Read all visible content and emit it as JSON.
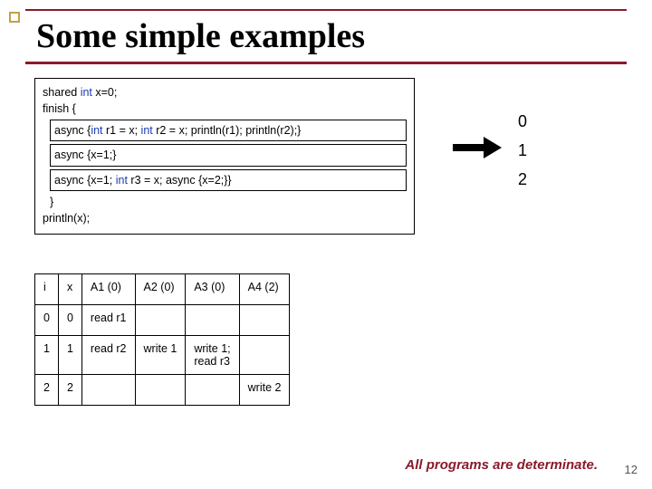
{
  "title": "Some simple examples",
  "code": {
    "line1_pre": "shared ",
    "line1_kw": "int",
    "line1_post": " x=0;",
    "line2": "finish {",
    "box1_pre": "async {",
    "box1_kw1": "int",
    "box1_mid1": " r1 = x; ",
    "box1_kw2": "int",
    "box1_mid2": " r2 = x; println(r1); println(r2);}",
    "box2": "async {x=1;}",
    "box3_pre": "async {x=1; ",
    "box3_kw": "int",
    "box3_post": " r3 = x; async {x=2;}}",
    "line_close": "}",
    "line_last": "println(x);"
  },
  "annotations": {
    "a0": "0",
    "a1": "1",
    "a2": "2"
  },
  "table": {
    "headers": {
      "i": "i",
      "x": "x",
      "a1": "A1 (0)",
      "a2": "A2 (0)",
      "a3": "A3 (0)",
      "a4": "A4 (2)"
    },
    "rows": [
      {
        "i": "0",
        "x": "0",
        "a1": "read r1",
        "a2": "",
        "a3": "",
        "a4": ""
      },
      {
        "i": "1",
        "x": "1",
        "a1": "read r2",
        "a2": "write 1",
        "a3": "write 1;\nread r3",
        "a4": ""
      },
      {
        "i": "2",
        "x": "2",
        "a1": "",
        "a2": "",
        "a3": "",
        "a4": "write 2"
      }
    ]
  },
  "footer": "All programs are determinate.",
  "page": "12"
}
